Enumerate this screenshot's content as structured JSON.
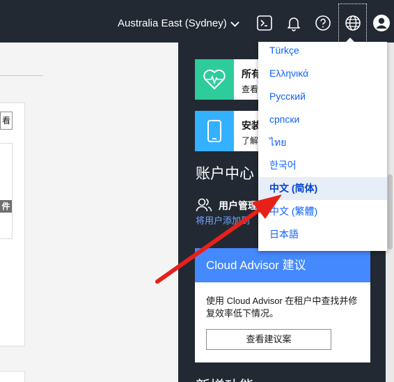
{
  "header": {
    "region_label": "Australia East (Sydney)",
    "icons": [
      "terminal-icon",
      "bell-icon",
      "help-icon",
      "globe-icon",
      "user-icon"
    ]
  },
  "left": {
    "button_fragment": "看",
    "tag_fragment": "件"
  },
  "sidebar": {
    "tile_all": {
      "title": "所有",
      "subtitle": "查看"
    },
    "tile_install": {
      "title": "安装",
      "subtitle": "了解"
    },
    "account_center": "账户中心",
    "user_mgmt": {
      "title": "用户管理",
      "subtitle": "将用户添加到"
    },
    "cloud_advisor": {
      "title": "Cloud Advisor 建议",
      "body": "使用 Cloud Advisor 在租户中查找并修复效率低下情况。",
      "button": "查看建议案"
    },
    "new_features": "新增功能"
  },
  "language_menu": {
    "items": [
      "Türkçe",
      "Ελληνικά",
      "Русский",
      "српски",
      "ไทย",
      "한국어",
      "中文 (简体)",
      "中文 (繁體)",
      "日本語"
    ],
    "selected_index": 6
  },
  "colors": {
    "header_bg": "#222933",
    "accent_blue": "#4589ff",
    "link_blue": "#0f62fe",
    "tile_green": "#2ecc9a",
    "tile_cyan": "#33b1ff",
    "annotation_red": "#e8201a"
  }
}
